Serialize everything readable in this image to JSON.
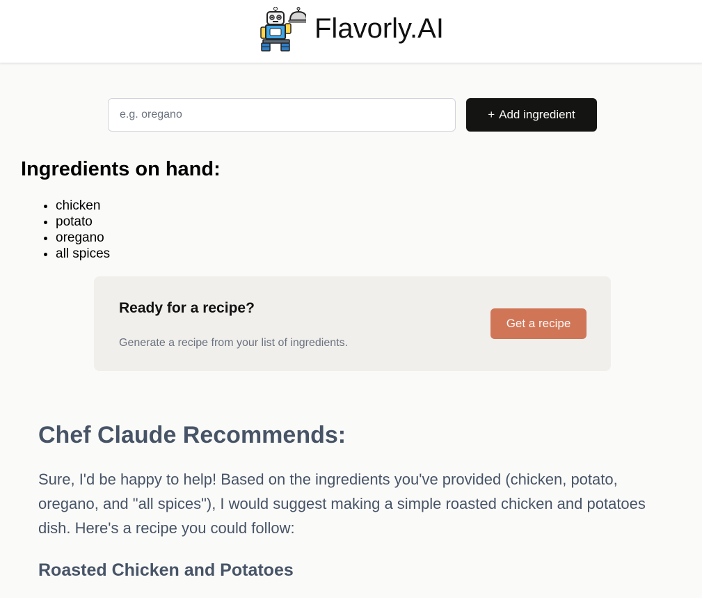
{
  "header": {
    "brand": "Flavorly.AI",
    "logo_icon": "robot-chef-icon"
  },
  "ingredient_form": {
    "placeholder": "e.g. oregano",
    "value": "",
    "add_button_icon": "+",
    "add_button_label": "Add ingredient"
  },
  "ingredients": {
    "title": "Ingredients on hand:",
    "items": [
      "chicken",
      "potato",
      "oregano",
      "all spices"
    ]
  },
  "recipe_card": {
    "title": "Ready for a recipe?",
    "description": "Generate a recipe from your list of ingredients.",
    "button_label": "Get a recipe"
  },
  "recommendation": {
    "heading": "Chef Claude Recommends:",
    "body": "Sure, I'd be happy to help! Based on the ingredients you've provided (chicken, potato, oregano, and \"all spices\"), I would suggest making a simple roasted chicken and potatoes dish. Here's a recipe you could follow:",
    "recipe_title": "Roasted Chicken and Potatoes"
  },
  "colors": {
    "accent": "#d17557",
    "dark_button": "#141413",
    "card_background": "#f0efeb",
    "recommendation_text": "#475467"
  }
}
